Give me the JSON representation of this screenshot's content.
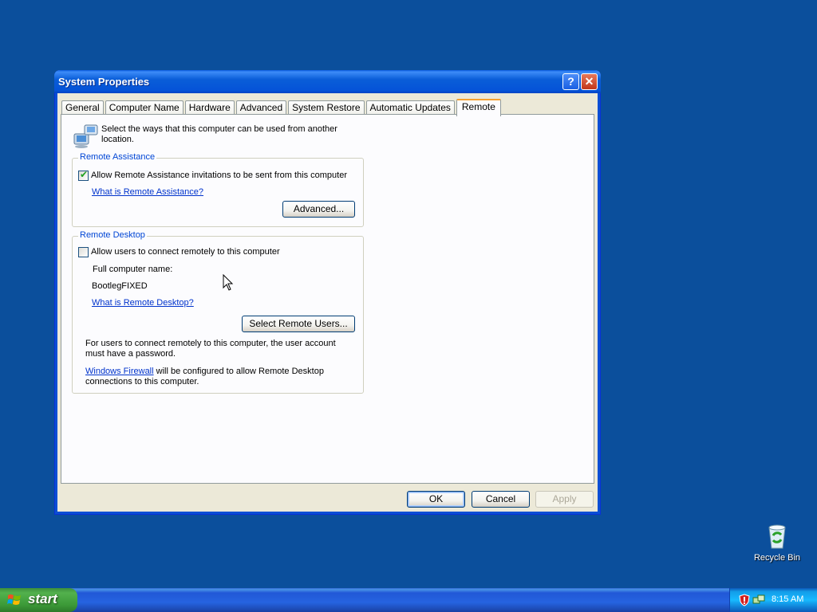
{
  "window": {
    "title": "System Properties",
    "help_glyph": "?",
    "close_glyph": "✕"
  },
  "tabs": [
    "General",
    "Computer Name",
    "Hardware",
    "Advanced",
    "System Restore",
    "Automatic Updates",
    "Remote"
  ],
  "active_tab": "Remote",
  "remote": {
    "intro": "Select the ways that this computer can be used from another location.",
    "assistance": {
      "group_title": "Remote Assistance",
      "checkbox_label": "Allow Remote Assistance invitations to be sent from this computer",
      "checked": true,
      "link": "What is Remote Assistance?",
      "advanced_button": "Advanced..."
    },
    "desktop": {
      "group_title": "Remote Desktop",
      "checkbox_label": "Allow users to connect remotely to this computer",
      "checked": false,
      "full_name_label": "Full computer name:",
      "full_name_value": "BootlegFIXED",
      "link": "What is Remote Desktop?",
      "select_users_button": "Select Remote Users...",
      "password_note": "For users to connect remotely to this computer, the user account must have a password.",
      "firewall_link": "Windows Firewall",
      "firewall_note": " will be configured to allow Remote Desktop connections to this computer."
    }
  },
  "buttons": {
    "ok": "OK",
    "cancel": "Cancel",
    "apply": "Apply"
  },
  "desktop": {
    "recycle_bin": "Recycle Bin"
  },
  "taskbar": {
    "start_label": "start",
    "clock": "8:15 AM"
  },
  "colors": {
    "desktop_bg": "#0b4f9c",
    "title_blue": "#0a5ce2",
    "group_title": "#0046d5",
    "link": "#0033cc",
    "start_green": "#3c9a38"
  }
}
